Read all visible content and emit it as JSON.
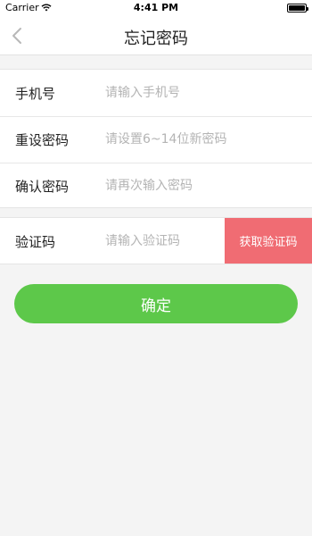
{
  "status_bar": {
    "carrier": "Carrier",
    "time": "4:41 PM",
    "wifi_icon": "wifi-icon",
    "battery_icon": "battery-icon"
  },
  "nav": {
    "title": "忘记密码",
    "back_icon": "chevron-left-icon"
  },
  "form": {
    "phone": {
      "label": "手机号",
      "placeholder": "请输入手机号"
    },
    "new_password": {
      "label": "重设密码",
      "placeholder": "请设置6~14位新密码"
    },
    "confirm_password": {
      "label": "确认密码",
      "placeholder": "请再次输入密码"
    },
    "verify_code": {
      "label": "验证码",
      "placeholder": "请输入验证码",
      "button_label": "获取验证码"
    }
  },
  "confirm_button": {
    "label": "确定"
  },
  "colors": {
    "accent_green": "#5dc84a",
    "accent_red": "#f06c73",
    "background": "#f4f4f4"
  }
}
